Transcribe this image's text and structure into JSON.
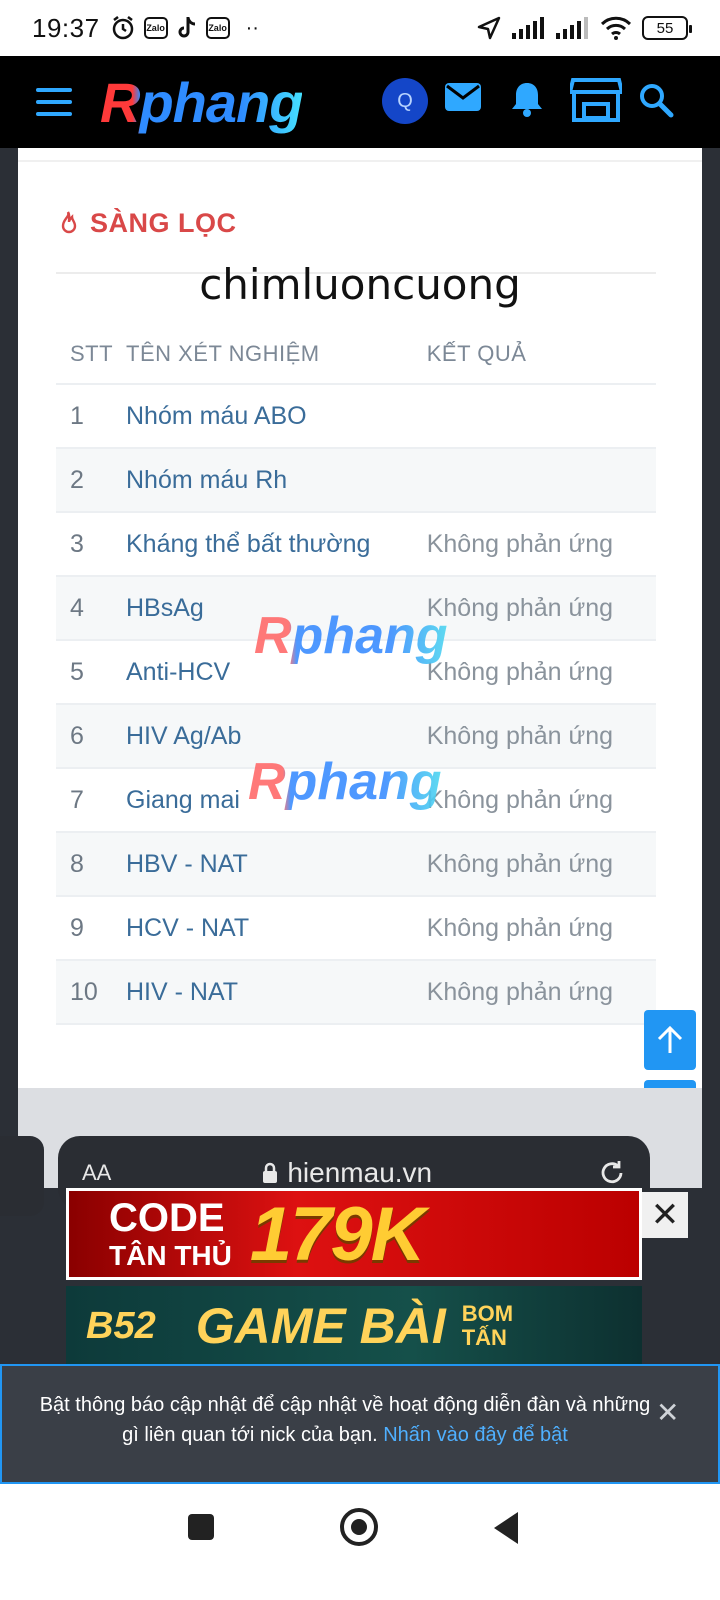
{
  "status_bar": {
    "time": "19:37",
    "app_icons": [
      "alarm-icon",
      "zalo-icon",
      "tiktok-icon",
      "zalo-icon"
    ],
    "zalo_label": "Zalo",
    "more": "··",
    "battery": "55"
  },
  "top_nav": {
    "logo": "Rphang",
    "avatar_letter": "Q",
    "icons": [
      "menu-icon",
      "avatar",
      "mail-icon",
      "bell-icon",
      "store-icon",
      "search-icon"
    ]
  },
  "screening": {
    "section_title": "SÀNG LỌC",
    "username": "chimluoncuong",
    "columns": [
      "STT",
      "TÊN XÉT NGHIỆM",
      "KẾT QUẢ"
    ],
    "rows": [
      {
        "stt": "1",
        "name": "Nhóm máu ABO",
        "result": ""
      },
      {
        "stt": "2",
        "name": "Nhóm máu Rh",
        "result": ""
      },
      {
        "stt": "3",
        "name": "Kháng thể bất thường",
        "result": "Không phản ứng"
      },
      {
        "stt": "4",
        "name": "HBsAg",
        "result": "Không phản ứng"
      },
      {
        "stt": "5",
        "name": "Anti-HCV",
        "result": "Không phản ứng"
      },
      {
        "stt": "6",
        "name": "HIV Ag/Ab",
        "result": "Không phản ứng"
      },
      {
        "stt": "7",
        "name": "Giang mai",
        "result": "Không phản ứng"
      },
      {
        "stt": "8",
        "name": "HBV - NAT",
        "result": "Không phản ứng"
      },
      {
        "stt": "9",
        "name": "HCV - NAT",
        "result": "Không phản ứng"
      },
      {
        "stt": "10",
        "name": "HIV - NAT",
        "result": "Không phản ứng"
      }
    ],
    "watermark": "Rphang"
  },
  "browser_bar": {
    "text_size_label": "AA",
    "url": "hienmau.vn"
  },
  "ads": {
    "ad1_line1": "CODE",
    "ad1_line2": "TÂN THỦ",
    "ad1_amount": "179K",
    "ad2_brand": "B52",
    "ad2_title": "GAME BÀI",
    "ad2_line1": "BOM",
    "ad2_line2": "TẤN"
  },
  "notification": {
    "message": "Bật thông báo cập nhật để cập nhật về hoạt động diễn đàn và những gì liên quan tới nick của bạn.",
    "link": "Nhấn vào đây để bật"
  },
  "colors": {
    "accent_blue": "#2196f3",
    "title_red": "#d94848",
    "link_blue": "#3a6c99"
  }
}
